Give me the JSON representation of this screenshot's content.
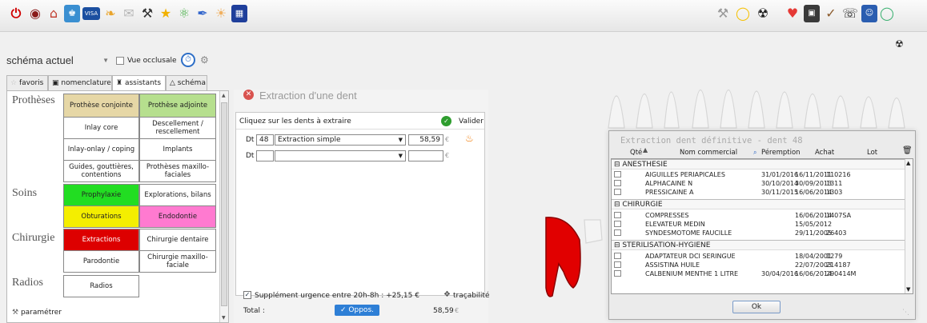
{
  "toolbar": {
    "left_icons": [
      "power-icon",
      "binoculars-icon",
      "home-icon",
      "patient-card-icon",
      "credit-card-icon",
      "medication-icon",
      "mail-icon",
      "surgery-icon",
      "trophy-icon",
      "chemistry-icon",
      "pen-icon",
      "sun-icon",
      "calendar-icon"
    ],
    "right_icons": [
      "tools-icon",
      "chat-bubble-icon",
      "radiation-icon",
      "heart-icon",
      "book-icon",
      "dental-probe-icon",
      "phone-icon",
      "contact-icon",
      "tooth-icon"
    ]
  },
  "schema_select": {
    "value": "schéma actuel",
    "vue_occlusale_label": "Vue occlusale"
  },
  "tabs": [
    {
      "label": "favoris",
      "icon": "star-icon",
      "active": false
    },
    {
      "label": "nomenclature",
      "icon": "book-icon",
      "active": false
    },
    {
      "label": "assistants",
      "icon": "assistant-icon",
      "active": true
    },
    {
      "label": "schéma",
      "icon": "tooth-icon",
      "active": false
    }
  ],
  "categories": {
    "protheses": "Prothèses",
    "soins": "Soins",
    "chirurgie": "Chirurgie",
    "radios": "Radios"
  },
  "buttons": {
    "prothese_conjointe": "Prothèse conjointe",
    "prothese_adjointe": "Prothèse adjointe",
    "inlay_core": "Inlay core",
    "descellement": "Descellement / rescellement",
    "inlay_onlay": "Inlay-onlay / coping",
    "implants": "Implants",
    "guides": "Guides, gouttières, contentions",
    "protheses_mf": "Prothèses maxillo-faciales",
    "prophylaxie": "Prophylaxie",
    "explorations": "Explorations, bilans",
    "obturations": "Obturations",
    "endodontie": "Endodontie",
    "extractions": "Extractions",
    "chirurgie_dentaire": "Chirurgie dentaire",
    "parodontie": "Parodontie",
    "chirurgie_mf": "Chirurgie maxillo-faciale",
    "radios": "Radios"
  },
  "parametrer": "paramétrer",
  "colors": {
    "beige": "#e6d7a6",
    "light_green": "#b6df8e",
    "green": "#22dd22",
    "yellow": "#f4ee00",
    "pink": "#ff7ad0",
    "red": "#dd0000"
  },
  "extraction": {
    "title": "Extraction d'une dent",
    "instruction": "Cliquez sur les dents à extraire",
    "valider": "Valider",
    "row1": {
      "prefix": "Dt",
      "tooth": "48",
      "acte": "Extraction simple",
      "price": "58,59",
      "currency": "€"
    },
    "row2": {
      "prefix": "Dt",
      "tooth": "",
      "acte": "",
      "price": "",
      "currency": "€"
    },
    "supplement": "Supplément urgence entre 20h-8h : +25,15 €",
    "tracabilite": "traçabilité",
    "total_label": "Total :",
    "oppos_label": "Oppos.",
    "total_value": "58,59",
    "total_currency": "€"
  },
  "dialog": {
    "title": "Extraction dent définitive - dent 48",
    "columns": [
      "Qté",
      "Nom commercial",
      "Péremption",
      "Achat",
      "Lot"
    ],
    "groups": [
      {
        "name": "ANESTHESIE",
        "items": [
          {
            "name": "AIGUILLES PERIAPICALES",
            "peremption": "31/01/2016",
            "achat": "16/11/2011",
            "lot": "110216"
          },
          {
            "name": "ALPHACAINE N",
            "peremption": "30/10/2014",
            "achat": "30/09/2013",
            "lot": "1311"
          },
          {
            "name": "PRESSICAINE A",
            "peremption": "30/11/2015",
            "achat": "16/06/2014",
            "lot": "1303"
          }
        ]
      },
      {
        "name": "CHIRURGIE",
        "items": [
          {
            "name": "COMPRESSES",
            "peremption": "",
            "achat": "16/06/2014",
            "lot": "1407SA"
          },
          {
            "name": "ELEVATEUR MEDIN",
            "peremption": "",
            "achat": "15/05/2012",
            "lot": ""
          },
          {
            "name": "SYNDESMOTOME FAUCILLE",
            "peremption": "",
            "achat": "29/11/2005",
            "lot": "26403"
          }
        ]
      },
      {
        "name": "STERILISATION-HYGIENE",
        "items": [
          {
            "name": "ADAPTATEUR DCI SERINGUE",
            "peremption": "",
            "achat": "18/04/2001",
            "lot": "1279"
          },
          {
            "name": "ASSISTINA HUILE",
            "peremption": "",
            "achat": "22/07/2003",
            "lot": "214187"
          },
          {
            "name": "CALBENIUM MENTHE 1 LITRE",
            "peremption": "30/04/2016",
            "achat": "16/06/2014",
            "lot": "290414M"
          }
        ]
      }
    ],
    "ok_label": "Ok"
  }
}
